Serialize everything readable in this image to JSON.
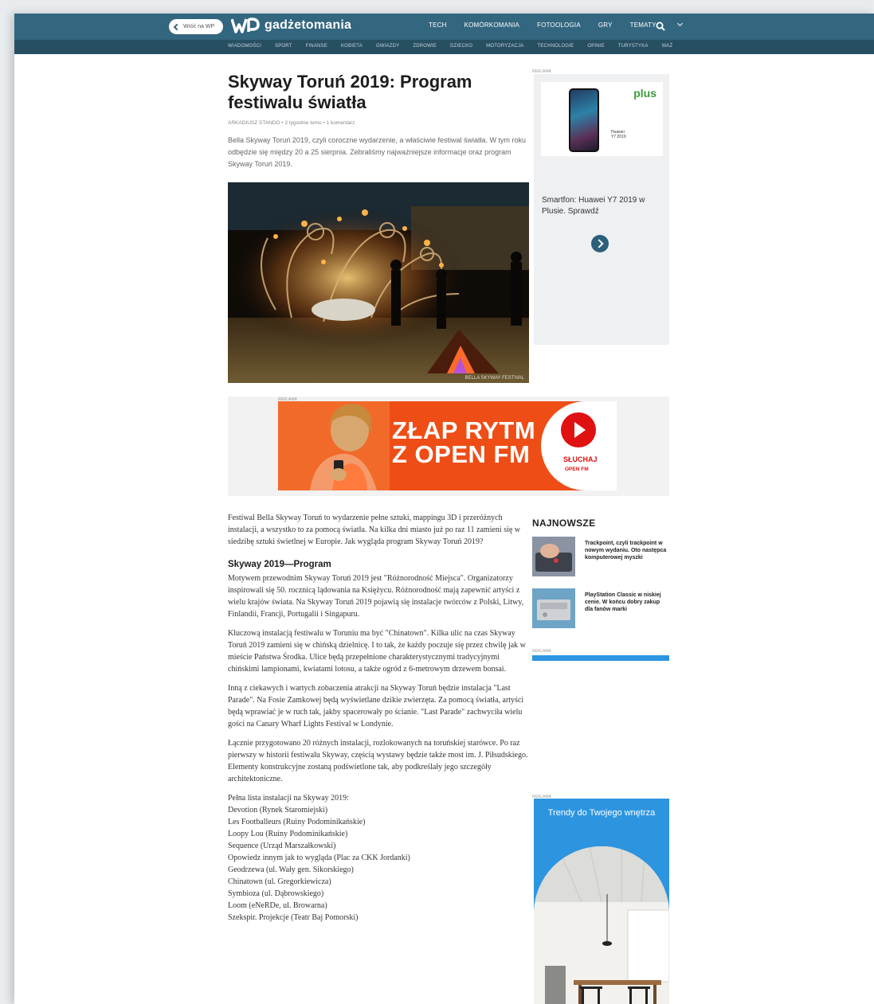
{
  "header": {
    "back_label": "Wróć na WP",
    "logo_text": "gadżetomania",
    "nav": [
      "TECH",
      "KOMÓRKOMANIA",
      "FOTOOLOGIA",
      "GRY",
      "TEMATY"
    ],
    "subnav": [
      "WIADOMOŚCI",
      "SPORT",
      "FINANSE",
      "KOBIETA",
      "GWIAZDY",
      "ZDROWIE",
      "DZIECKO",
      "MOTORYZACJA",
      "TECHNOLOGIE",
      "OPINIE",
      "TURYSTYKA",
      "WAŻ"
    ],
    "bar_color": "#33667f",
    "subbar_color": "#274f62"
  },
  "article": {
    "title": "Skyway Toruń 2019: Program festiwalu światła",
    "byline": "ARKADIUSZ STANDO • 2 tygodnie temu • 1 komentarz",
    "lead": "Bella Skyway Toruń 2019, czyli coroczne wydarzenie, a właściwie festiwal światła. W tym roku odbędzie się między 20 a 25 sierpnia. Zebraliśmy najważniejsze informacje oraz program Skyway Toruń 2019.",
    "hero_credit": "BELLA SKYWAY FESTIVAL",
    "p1": "Festiwal Bella Skyway Toruń to wydarzenie pełne sztuki, mappingu 3D i przeróżnych instalacji, a wszystko to za pomocą światła. Na kilka dni miasto już po raz 11 zamieni się w siedzibę sztuki świetlnej w Europie. Jak wygląda program Skyway Toruń 2019?",
    "h2": "Skyway 2019—Program",
    "p2": "Motywem przewodnim Skyway Toruń 2019 jest \"Różnorodność Miejsca\". Organizatorzy inspirowali się 50. rocznicą lądowania na Księżycu. Różnorodność mają zapewnić artyści z wielu krajów świata. Na Skyway Toruń 2019 pojawią się instalacje twórców z Polski, Litwy, Finlandii, Francji, Portugalii i Singapuru.",
    "p3": "Kluczową instalacją festiwalu w Toruniu ma być \"Chinatown\". Kilka ulic na czas Skyway Toruń 2019 zamieni się w chińską dzielnicę. I to tak, że każdy poczuje się przez chwilę jak w mieście Państwa Środka. Ulice będą przepełnione charakterystycznymi tradycyjnymi chińskimi lampionami, kwiatami lotosu, a także ogród z 6-metrowym drzewem bonsai.",
    "p4": "Inną z ciekawych i wartych zobaczenia atrakcji na Skyway Toruń będzie instalacja \"Last Parade\". Na Fosie Zamkowej będą wyświetlane dzikie zwierzęta. Za pomocą światła, artyści będą wprawiać je w ruch tak, jakby spacerowały po ścianie. \"Last Parade\" zachwyciła wielu gości na Canary Wharf Lights Festival w Londynie.",
    "p5": "Łącznie przygotowano 20 różnych instalacji, rozlokowanych na toruńskiej starówce. Po raz pierwszy w historii festiwalu Skyway, częścią wystawy będzie także most im. J. Piłsudskiego. Elementy konstrukcyjne zostaną podświetlone tak, aby podkreślały jego szczegóły architektoniczne.",
    "list_title": "Pełna lista instalacji na Skyway 2019:",
    "installations": [
      "Devotion (Rynek Staromiejski)",
      "Les Footballeurs (Ruiny Podominikańskie)",
      "Loopy Lou (Ruiny Podominikańskie)",
      "Sequence (Urząd Marszałkowski)",
      "Opowiedz innym jak to wygląda (Plac za CKK Jordanki)",
      "Geodrzewa (ul. Wały gen. Sikorskiego)",
      "Chinatown (ul. Gregorkiewicza)",
      "Symbioza (ul. Dąbrowskiego)",
      "Loom (eNeRDe, ul. Browarna)",
      "Szekspir. Projekcje (Teatr Baj Pomorski)"
    ]
  },
  "ads": {
    "label": "REKLAMA",
    "right": {
      "brand": "plus",
      "phone_label_1": "Huawei",
      "phone_label_2": "Y7 2019",
      "text": "Smartfon: Huawei Y7 2019 w Plusie. Sprawdź"
    },
    "banner": {
      "line1": "ZŁAP RYTM",
      "line2": "Z OPEN FM",
      "cta": "SŁUCHAJ",
      "brand": "OPEN FM"
    },
    "trendy": "Trendy do Twojego wnętrza"
  },
  "sidebar": {
    "title": "NAJNOWSZE",
    "items": [
      {
        "text": "Trackpoint, czyli trackpoint w nowym wydaniu. Oto następca komputerowej myszki"
      },
      {
        "text": "PlayStation Classic w niskiej cenie. W końcu dobry zakup dla fanów marki"
      }
    ]
  }
}
